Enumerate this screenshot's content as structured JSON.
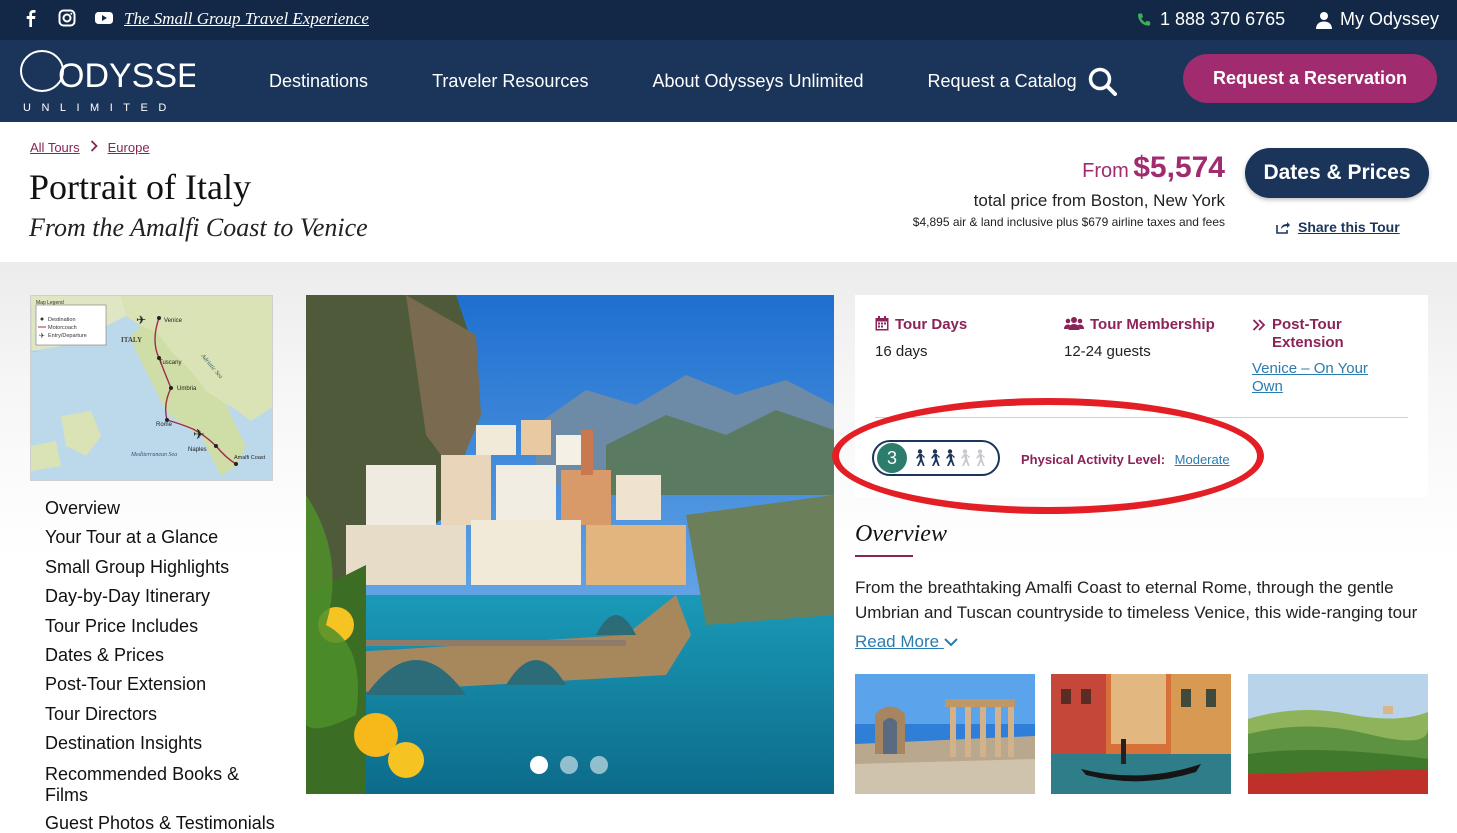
{
  "topbar": {
    "tagline": "The Small Group Travel Experience",
    "phone": "1 888 370 6765",
    "account": "My Odyssey"
  },
  "logo": {
    "name": "ODYSSEYS",
    "sub": "UNLIMITED"
  },
  "nav": {
    "links": [
      "Destinations",
      "Traveler Resources",
      "About Odysseys Unlimited",
      "Request a Catalog"
    ],
    "reserve": "Request a Reservation"
  },
  "breadcrumb": [
    "All Tours",
    "Europe"
  ],
  "tour": {
    "title": "Portrait of Italy",
    "subtitle": "From the Amalfi Coast to Venice",
    "price_from": "From",
    "price": "$5,574",
    "price_sub": "total price from Boston, New York",
    "price_fine": "$4,895 air & land inclusive plus $679 airline taxes and fees",
    "dates_button": "Dates & Prices",
    "share": "Share this Tour"
  },
  "map": {
    "legend_title": "Map Legend",
    "legend": [
      "Destination",
      "Motorcoach",
      "Entry/Departure"
    ],
    "labels": [
      "ITALY",
      "Venice",
      "Tuscany",
      "Umbria",
      "Rome",
      "Naples",
      "Amalfi Coast",
      "Adriatic Sea",
      "Mediterranean Sea"
    ]
  },
  "sidenav": [
    "Overview",
    "Your Tour at a Glance",
    "Small Group Highlights",
    "Day-by-Day Itinerary",
    "Tour Price Includes",
    "Dates & Prices",
    "Post-Tour Extension",
    "Tour Directors",
    "Destination Insights",
    "Recommended Books & Films",
    "Guest Photos & Testimonials"
  ],
  "info": {
    "days_label": "Tour Days",
    "days_value": "16 days",
    "members_label": "Tour Membership",
    "members_value": "12-24 guests",
    "ext_label": "Post-Tour Extension",
    "ext_link": "Venice – On Your Own",
    "activity_num": "3",
    "activity_level_value": 3,
    "activity_level_max": 5,
    "activity_label": "Physical Activity Level:",
    "activity_level": "Moderate"
  },
  "overview": {
    "title": "Overview",
    "text": "From the breathtaking Amalfi Coast to eternal Rome, through the gentle Umbrian and Tuscan countryside to timeless Venice, this wide-ranging tour",
    "read_more": "Read More"
  },
  "carousel": {
    "slides": 3,
    "active": 1
  },
  "colors": {
    "navy": "#1b355a",
    "magenta": "#a02b6e",
    "teal": "#2d7d6c",
    "highlight": "#e31e24"
  }
}
